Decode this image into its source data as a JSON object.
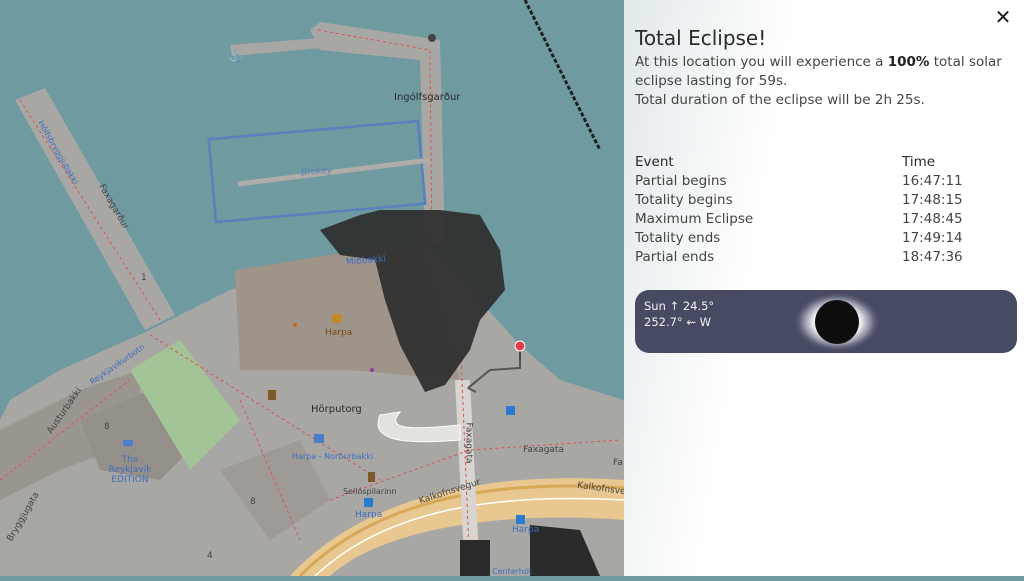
{
  "map": {
    "labels": {
      "ingolfsgardur": "Ingólfsgarður",
      "brokey": "Brokey",
      "faxagardur": "Faxagarður",
      "holmsbakki": "Hólfsbryggjubakki",
      "midbakki": "Miðbakki",
      "harpa": "Harpa",
      "horputorg": "Hörputorg",
      "austurbakki": "Austurbakki",
      "reykjavik_edition": "The Reykjavík EDITION",
      "faxagata": "Faxagata",
      "faxagata_arrow": "Faxagata",
      "kalkofnsvegur": "Kalkofnsvegur",
      "kalkofnsvegur2": "Kalkofnsvegur",
      "sellosplan": "Sellóspilarinn",
      "harpa_bus": "Harpa",
      "harpa_bus2": "Harpa",
      "reykjavikurbotn": "Reykjavíkurbotn",
      "num8": "8",
      "num8b": "8",
      "num4": "4",
      "num1": "1",
      "centerhotel": "Centerhót",
      "bryggjugata": "Bryggjugata",
      "harpa_nordur": "Harpa - Norðurbakki",
      "fa": "Fa"
    },
    "marker_color": "#e23d48"
  },
  "panel": {
    "close_icon": "close-icon",
    "title": "Total Eclipse!",
    "desc_prefix": "At this location you will experience a ",
    "desc_bold": "100%",
    "desc_suffix": " total solar eclipse lasting for 59s.",
    "desc_line2": "Total duration of the eclipse will be 2h 25s.",
    "events_header": {
      "event": "Event",
      "time": "Time"
    },
    "events": [
      {
        "event": "Partial begins",
        "time": "16:47:11"
      },
      {
        "event": "Totality begins",
        "time": "17:48:15"
      },
      {
        "event": "Maximum Eclipse",
        "time": "17:48:45"
      },
      {
        "event": "Totality ends",
        "time": "17:49:14"
      },
      {
        "event": "Partial ends",
        "time": "18:47:36"
      }
    ],
    "sun": {
      "altitude": "Sun ↑ 24.5°",
      "azimuth": "252.7° ⇜ W",
      "box_color": "#474a63"
    }
  }
}
